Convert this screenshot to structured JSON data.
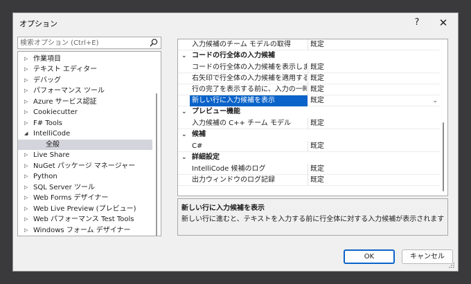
{
  "dialog": {
    "title": "オプション",
    "help_label": "?",
    "close_label": "✕"
  },
  "search": {
    "placeholder": "検索オプション (Ctrl+E)"
  },
  "tree": {
    "items": [
      {
        "label": "作業項目",
        "arrow": "▷"
      },
      {
        "label": "テキスト エディター",
        "arrow": "▷"
      },
      {
        "label": "デバッグ",
        "arrow": "▷"
      },
      {
        "label": "パフォーマンス ツール",
        "arrow": "▷"
      },
      {
        "label": "Azure サービス認証",
        "arrow": "▷"
      },
      {
        "label": "Cookiecutter",
        "arrow": "▷"
      },
      {
        "label": "F# Tools",
        "arrow": "▷"
      },
      {
        "label": "IntelliCode",
        "arrow": "◢"
      },
      {
        "label": "全般",
        "arrow": ""
      },
      {
        "label": "Live Share",
        "arrow": "▷"
      },
      {
        "label": "NuGet パッケージ マネージャー",
        "arrow": "▷"
      },
      {
        "label": "Python",
        "arrow": "▷"
      },
      {
        "label": "SQL Server ツール",
        "arrow": "▷"
      },
      {
        "label": "Web Forms デザイナー",
        "arrow": "▷"
      },
      {
        "label": "Web Live Preview (プレビュー)",
        "arrow": "▷"
      },
      {
        "label": "Web パフォーマンス Test Tools",
        "arrow": "▷"
      },
      {
        "label": "Windows フォーム デザイナー",
        "arrow": "▷"
      }
    ]
  },
  "grid": {
    "rows": [
      {
        "name": "入力候補のチーム モデルの取得",
        "value": "既定"
      },
      {
        "category": "コードの行全体の入力候補",
        "exp": "⌄"
      },
      {
        "name": "コードの行全体の入力候補を表示します",
        "value": "既定"
      },
      {
        "name": "右矢印で行全体の入力候補を適用する",
        "value": "既定"
      },
      {
        "name": "行の完了を表示する前に、入力の一時停止を待機します",
        "value": "既定"
      },
      {
        "name": "新しい行に入力候補を表示",
        "value": "既定",
        "dropdown": "⌄"
      },
      {
        "category": "プレビュー機能",
        "exp": "⌄"
      },
      {
        "name": "入力候補の C++ チーム モデル",
        "value": "既定"
      },
      {
        "category": "候補",
        "exp": "⌄"
      },
      {
        "name": "C#",
        "value": "既定"
      },
      {
        "category": "詳細設定",
        "exp": "⌄"
      },
      {
        "name": "IntelliCode 候補のログ",
        "value": "既定"
      },
      {
        "name": "出力ウィンドウのログ記録",
        "value": "既定"
      }
    ]
  },
  "description": {
    "title": "新しい行に入力候補を表示",
    "text": "新しい行に進むと、テキストを入力する前に行全体に対する入力候補が表示されます"
  },
  "buttons": {
    "ok": "OK",
    "cancel": "キャンセル"
  },
  "colors": {
    "selection": "#0a63c9",
    "tree_selection": "#d4d4dc"
  }
}
